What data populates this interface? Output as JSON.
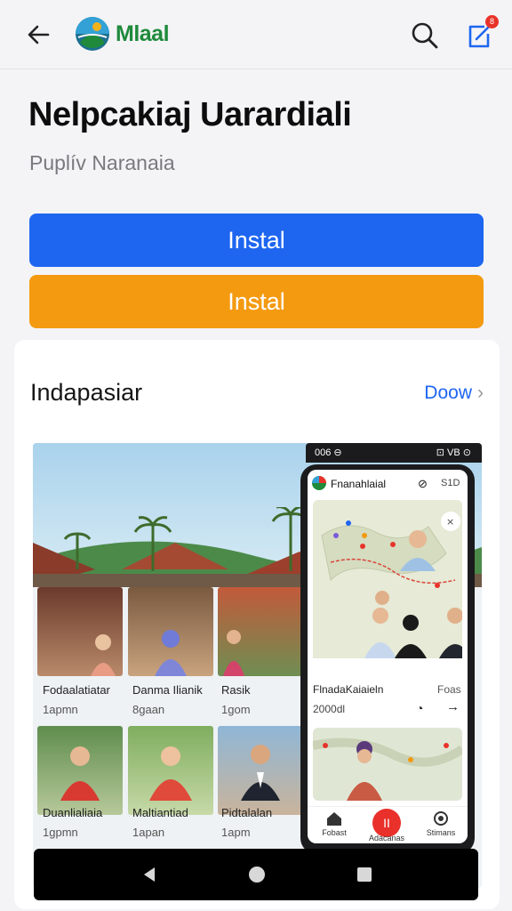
{
  "appbar": {
    "brand": "Mlaal",
    "back_icon": "arrow-left-icon",
    "search_icon": "search-icon",
    "edit_icon": "edit-icon",
    "badge": "8",
    "colors": {
      "brand": "#1f8a3b",
      "badge": "#e8332a"
    }
  },
  "header": {
    "title": "Nelpcakiaj Uarardiali",
    "subtitle": "Puplív Naranaia"
  },
  "buttons": {
    "primary": {
      "label": "Instal",
      "color": "#1e66f0"
    },
    "secondary": {
      "label": "Instal",
      "color": "#f49a10"
    }
  },
  "card": {
    "title": "Indapasiar",
    "action": "Doow",
    "action_icon": "chevron-right-icon"
  },
  "gallery": {
    "tiles": [
      {
        "caption": "Fodaalatiatar",
        "sub": "1apmn"
      },
      {
        "caption": "Danma Ilianik",
        "sub": "8gaan"
      },
      {
        "caption": "Rasik",
        "sub": "1gom"
      },
      {
        "caption": "Duanlialiaia",
        "sub": "1gpmn"
      },
      {
        "caption": "Maltiantiad",
        "sub": "1apan"
      },
      {
        "caption": "Pidtalalan",
        "sub": "1apm"
      }
    ]
  },
  "phone": {
    "status_left": "006 ⊖",
    "status_right": "⊡ VB ⊙",
    "app_title": "Fnanahlaial",
    "app_meta": "S1D",
    "item_caption": "FlnadaKaiaieln",
    "item_right": "Foas",
    "item_sub": "2000dl",
    "nav": [
      {
        "label": "Fobast",
        "icon": "home-icon"
      },
      {
        "label": "Adacanas",
        "icon": "record-icon"
      },
      {
        "label": "Stimans",
        "icon": "settings-icon"
      }
    ],
    "record_label": "II"
  },
  "system_nav": {
    "back_icon": "triangle-back-icon",
    "home_icon": "circle-home-icon",
    "recents_icon": "square-recents-icon"
  }
}
